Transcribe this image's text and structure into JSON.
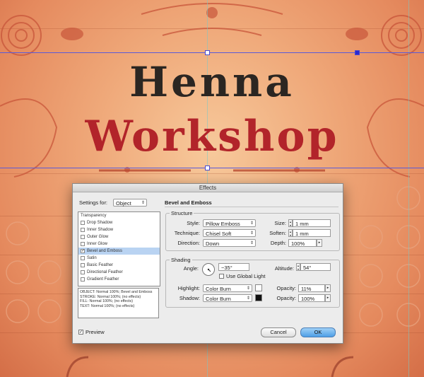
{
  "poster": {
    "title_line1": "Henna",
    "title_line2": "Workshop"
  },
  "dialog": {
    "title": "Effects",
    "settings_for_label": "Settings for:",
    "settings_for_value": "Object",
    "section_title": "Bevel and Emboss",
    "effects_list": {
      "header": "Transparency",
      "items": [
        {
          "label": "Drop Shadow",
          "checked": false
        },
        {
          "label": "Inner Shadow",
          "checked": false
        },
        {
          "label": "Outer Glow",
          "checked": false
        },
        {
          "label": "Inner Glow",
          "checked": false
        },
        {
          "label": "Bevel and Emboss",
          "checked": true
        },
        {
          "label": "Satin",
          "checked": false
        },
        {
          "label": "Basic Feather",
          "checked": false
        },
        {
          "label": "Directional Feather",
          "checked": false
        },
        {
          "label": "Gradient Feather",
          "checked": false
        }
      ]
    },
    "summary_lines": [
      "OBJECT: Normal 100%; Bevel and Emboss",
      "STROKE: Normal 100%; (no effects)",
      "FILL: Normal 100%; (no effects)",
      "TEXT: Normal 100%; (no effects)"
    ],
    "structure": {
      "heading": "Structure",
      "style_label": "Style:",
      "style_value": "Pillow Emboss",
      "technique_label": "Technique:",
      "technique_value": "Chisel Soft",
      "direction_label": "Direction:",
      "direction_value": "Down",
      "size_label": "Size:",
      "size_value": "1 mm",
      "soften_label": "Soften:",
      "soften_value": "1 mm",
      "depth_label": "Depth:",
      "depth_value": "100%"
    },
    "shading": {
      "heading": "Shading",
      "angle_label": "Angle:",
      "angle_value": "−35°",
      "global_light_label": "Use Global Light",
      "altitude_label": "Altitude:",
      "altitude_value": "54°",
      "highlight_label": "Highlight:",
      "highlight_value": "Color Burn",
      "highlight_color": "#ffffff",
      "shadow_label": "Shadow:",
      "shadow_value": "Color Burn",
      "shadow_color": "#111111",
      "opacity_label": "Opacity:",
      "highlight_opacity": "11%",
      "shadow_opacity": "100%"
    },
    "preview_label": "Preview",
    "cancel_label": "Cancel",
    "ok_label": "OK"
  },
  "colors": {
    "title_dark": "#2b2622",
    "title_red": "#b2242a",
    "guide": "#5a5ad8",
    "ok_button": "#4e9fe6"
  }
}
